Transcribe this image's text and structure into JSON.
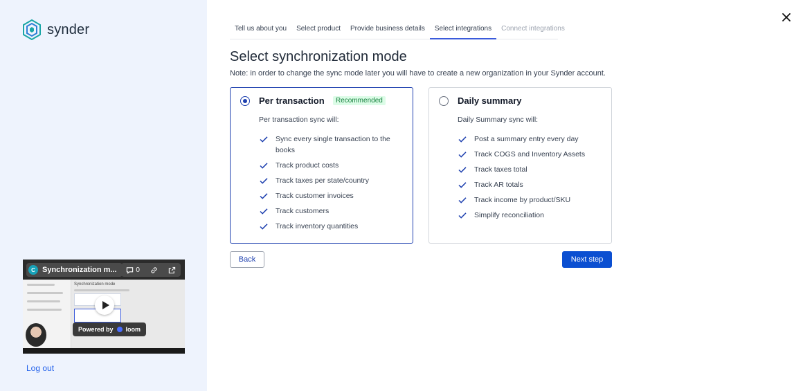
{
  "brand": {
    "name": "synder",
    "logo_icon": "synder-logo-icon"
  },
  "sidebar": {
    "video": {
      "title": "Synchronization m...",
      "avatar_letter": "C",
      "comment_count": "0",
      "powered_by": "Powered by",
      "provider": "loom",
      "preview_title": "Synchronization mode"
    },
    "logout_label": "Log out"
  },
  "steps": [
    {
      "label": "Tell us about you",
      "state": "done"
    },
    {
      "label": "Select product",
      "state": "done"
    },
    {
      "label": "Provide business details",
      "state": "done"
    },
    {
      "label": "Select integrations",
      "state": "active"
    },
    {
      "label": "Connect integrations",
      "state": "disabled"
    }
  ],
  "page": {
    "title": "Select synchronization mode",
    "note": "Note: in order to change the sync mode later you will have to create a new organization in your Synder account."
  },
  "options": [
    {
      "title": "Per transaction",
      "badge": "Recommended",
      "selected": true,
      "subtitle": "Per transaction sync will:",
      "features": [
        "Sync every single transaction to the books",
        "Track product costs",
        "Track taxes per state/country",
        "Track customer invoices",
        "Track customers",
        "Track inventory quantities"
      ]
    },
    {
      "title": "Daily summary",
      "selected": false,
      "subtitle": "Daily Summary sync will:",
      "features": [
        "Post a summary entry every day",
        "Track COGS and Inventory Assets",
        "Track taxes total",
        "Track AR totals",
        "Track income by product/SKU",
        "Simplify reconciliation"
      ]
    }
  ],
  "actions": {
    "back_label": "Back",
    "next_label": "Next step"
  },
  "colors": {
    "accent": "#0b4fd1",
    "selected_border": "#1e40af",
    "sidebar_bg": "#eef3fd",
    "badge_bg": "#dcfce7",
    "badge_text": "#15803d"
  }
}
